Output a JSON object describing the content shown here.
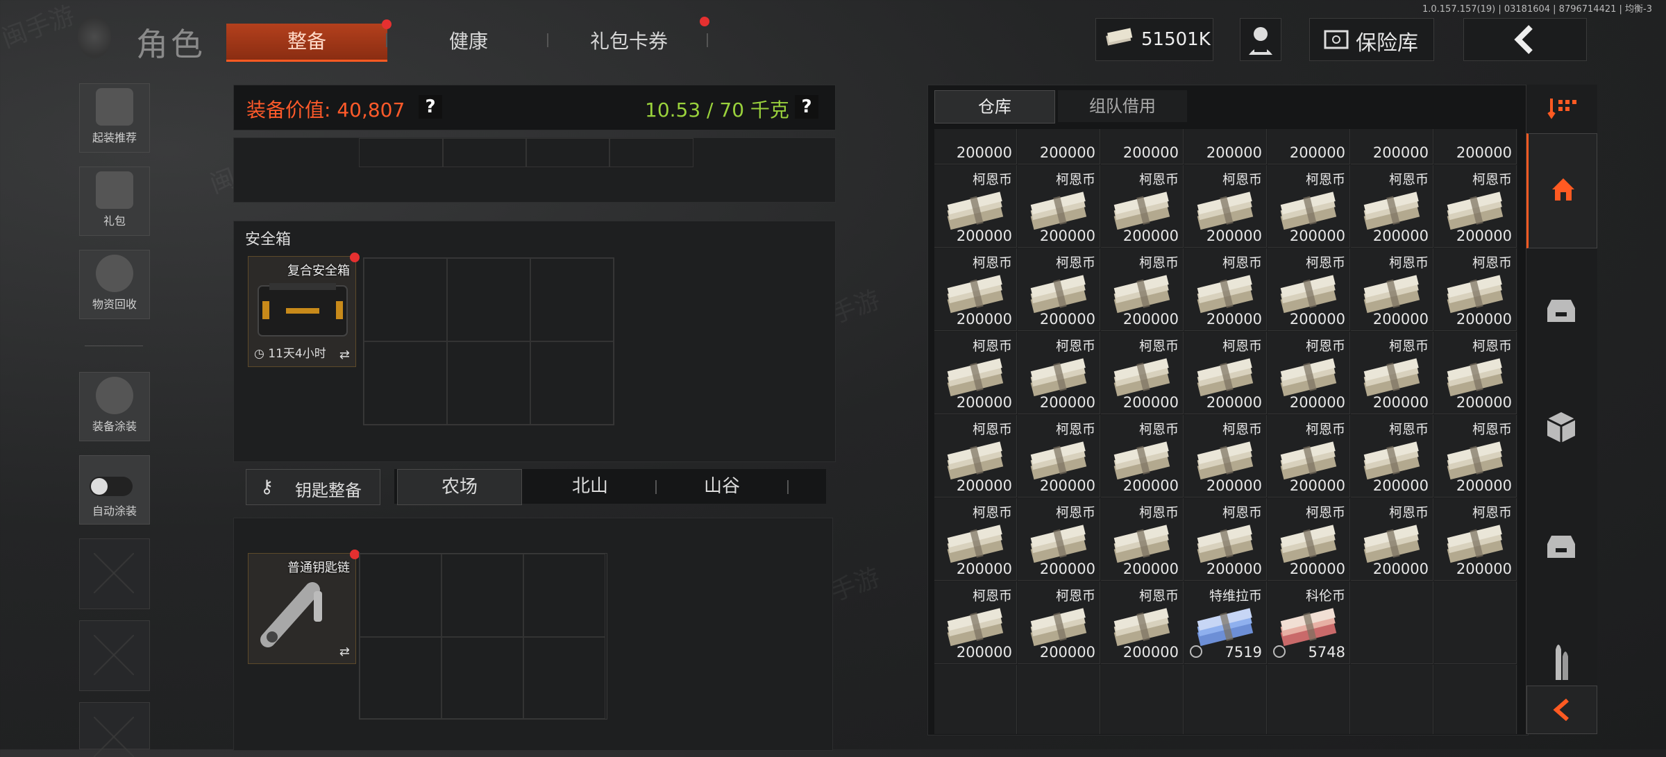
{
  "version": "1.0.157.157(19) | 03181604 | 8796714421 | 均衡-3",
  "header": {
    "title": "角色",
    "tabs": [
      {
        "label": "整备",
        "active": true,
        "badge": true
      },
      {
        "label": "健康",
        "active": false,
        "badge": false
      },
      {
        "label": "礼包卡券",
        "active": false,
        "badge": true
      }
    ],
    "money": "51501K",
    "vault_label": "保险库"
  },
  "left_rail": [
    {
      "label": "起装推荐",
      "icon": "helmet-recommend-icon"
    },
    {
      "label": "礼包",
      "icon": "gift-icon"
    },
    {
      "label": "物资回收",
      "icon": "recycle-icon"
    },
    {
      "label": "装备涂装",
      "icon": "helmet-paint-icon"
    },
    {
      "label": "自动涂装",
      "icon": "toggle-switch-icon"
    }
  ],
  "equip": {
    "value_label": "装备价值: 40,807",
    "weight_label": "10.53 / 70 千克",
    "help": "?"
  },
  "safebox": {
    "title": "安全箱",
    "item_name": "复合安全箱",
    "timer": "11天4小时"
  },
  "keys": {
    "button_label": "钥匙整备",
    "maps": [
      "农场",
      "北山",
      "山谷"
    ],
    "item_name": "普通钥匙链"
  },
  "warehouse": {
    "tabs": [
      "仓库",
      "组队借用"
    ],
    "partial_row_value": "200000",
    "rows": [
      [
        {
          "name": "柯恩币",
          "value": "200000"
        },
        {
          "name": "柯恩币",
          "value": "200000"
        },
        {
          "name": "柯恩币",
          "value": "200000"
        },
        {
          "name": "柯恩币",
          "value": "200000"
        },
        {
          "name": "柯恩币",
          "value": "200000"
        },
        {
          "name": "柯恩币",
          "value": "200000"
        },
        {
          "name": "柯恩币",
          "value": "200000"
        }
      ],
      [
        {
          "name": "柯恩币",
          "value": "200000"
        },
        {
          "name": "柯恩币",
          "value": "200000"
        },
        {
          "name": "柯恩币",
          "value": "200000"
        },
        {
          "name": "柯恩币",
          "value": "200000"
        },
        {
          "name": "柯恩币",
          "value": "200000"
        },
        {
          "name": "柯恩币",
          "value": "200000"
        },
        {
          "name": "柯恩币",
          "value": "200000"
        }
      ],
      [
        {
          "name": "柯恩币",
          "value": "200000"
        },
        {
          "name": "柯恩币",
          "value": "200000"
        },
        {
          "name": "柯恩币",
          "value": "200000"
        },
        {
          "name": "柯恩币",
          "value": "200000"
        },
        {
          "name": "柯恩币",
          "value": "200000"
        },
        {
          "name": "柯恩币",
          "value": "200000"
        },
        {
          "name": "柯恩币",
          "value": "200000"
        }
      ],
      [
        {
          "name": "柯恩币",
          "value": "200000"
        },
        {
          "name": "柯恩币",
          "value": "200000"
        },
        {
          "name": "柯恩币",
          "value": "200000"
        },
        {
          "name": "柯恩币",
          "value": "200000"
        },
        {
          "name": "柯恩币",
          "value": "200000"
        },
        {
          "name": "柯恩币",
          "value": "200000"
        },
        {
          "name": "柯恩币",
          "value": "200000"
        }
      ],
      [
        {
          "name": "柯恩币",
          "value": "200000"
        },
        {
          "name": "柯恩币",
          "value": "200000"
        },
        {
          "name": "柯恩币",
          "value": "200000"
        },
        {
          "name": "柯恩币",
          "value": "200000"
        },
        {
          "name": "柯恩币",
          "value": "200000"
        },
        {
          "name": "柯恩币",
          "value": "200000"
        },
        {
          "name": "柯恩币",
          "value": "200000"
        }
      ],
      [
        {
          "name": "柯恩币",
          "value": "200000"
        },
        {
          "name": "柯恩币",
          "value": "200000"
        },
        {
          "name": "柯恩币",
          "value": "200000"
        },
        {
          "name": "特维拉币",
          "value": "7519",
          "kind": "blue"
        },
        {
          "name": "科伦币",
          "value": "5748",
          "kind": "red"
        }
      ]
    ]
  },
  "watermark_text": "闽手游",
  "colors": {
    "accent": "#ff5a22",
    "value": "#ff5a2a",
    "weight": "#9ad23c"
  }
}
